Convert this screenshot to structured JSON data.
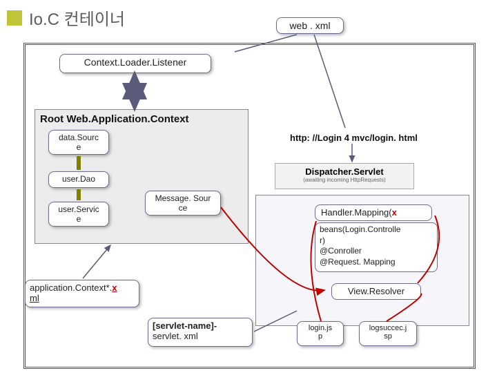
{
  "title": "Io.C 컨테이너",
  "webxml": "web . xml",
  "contextLoader": "Context.Loader.Listener",
  "rootCtx": "Root  Web.Application.Context",
  "dataSource": "data.Sourc\ne",
  "userDao": "user.Dao",
  "userService": "user.Servic\ne",
  "messageSource": "Message. Sour\nce",
  "url": "http: //Login 4 mvc/login. html",
  "dispatcher_title": "Dispatcher.Servlet",
  "dispatcher_sub": "(awaiting incoming HttpRequests)",
  "handlerMapping_pre": "Handler.Mapping(",
  "handlerMapping_x": "x",
  "beans": "beans(Login.Controlle\nr)\n@Conroller\n@Request. Mapping",
  "viewResolver": "View.Resolver",
  "appCtx_pre": "application.Context*.",
  "appCtx_x": "x",
  "appCtx_post": "ml",
  "servletXml_pre": "[servlet-name]-",
  "servletXml_post": "servlet. xml",
  "loginJsp": "login.js\np",
  "logSuccess": "logsuccec.j\nsp"
}
